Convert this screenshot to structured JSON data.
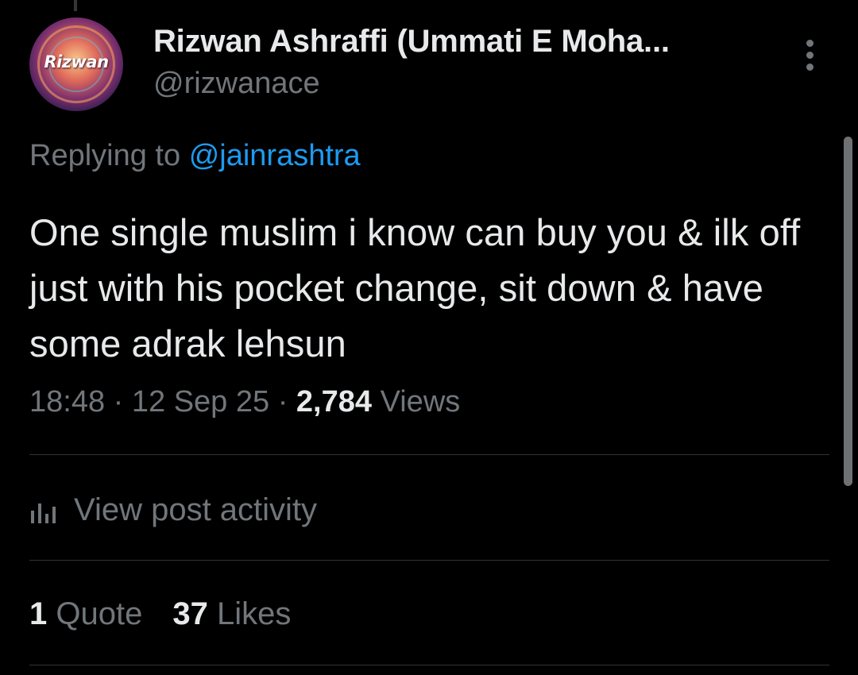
{
  "author": {
    "display_name": "Rizwan Ashraffi (Ummati E Moha...",
    "handle": "@rizwanace",
    "avatar_text": "Rizwan"
  },
  "more_icon": "more-vertical-icon",
  "reply": {
    "prefix": "Replying to",
    "mention": "@jainrashtra"
  },
  "post": {
    "text": "One single muslim i know can buy you & ilk off just with his pocket change, sit down & have some adrak lehsun"
  },
  "meta": {
    "time": "18:48",
    "separator": "·",
    "date": "12 Sep 25",
    "views_count": "2,784",
    "views_label": "Views"
  },
  "activity": {
    "icon": "analytics-bars-icon",
    "label": "View post activity"
  },
  "stats": {
    "quotes_count": "1",
    "quotes_label": "Quote",
    "likes_count": "37",
    "likes_label": "Likes"
  },
  "colors": {
    "background": "#000000",
    "primary_text": "#e7e9ea",
    "secondary_text": "#71767b",
    "link": "#1d9bf0",
    "divider": "#2f3336"
  }
}
